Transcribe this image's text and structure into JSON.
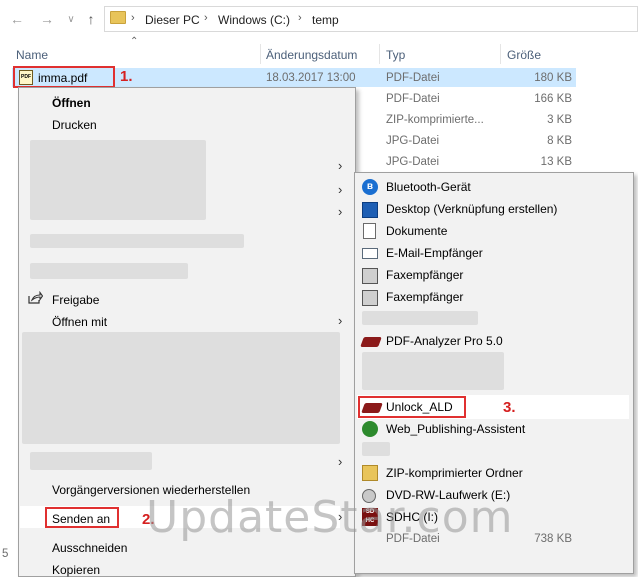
{
  "breadcrumb": [
    "Dieser PC",
    "Windows (C:)",
    "temp"
  ],
  "columns": {
    "name": "Name",
    "date": "Änderungsdatum",
    "type": "Typ",
    "size": "Größe"
  },
  "selected_file": {
    "name": "imma.pdf",
    "date": "18.03.2017 13:00",
    "type": "PDF-Datei",
    "size": "180 KB"
  },
  "files": [
    {
      "type": "PDF-Datei",
      "size": "166 KB"
    },
    {
      "type": "ZIP-komprimierte...",
      "size": "3 KB"
    },
    {
      "type": "JPG-Datei",
      "size": "8 KB"
    },
    {
      "type": "JPG-Datei",
      "size": "13 KB"
    }
  ],
  "last_row": {
    "type": "PDF-Datei",
    "size": "738 KB"
  },
  "left_stub": "5",
  "context_menu": {
    "open": "Öffnen",
    "print": "Drucken",
    "share": "Freigabe",
    "open_with": "Öffnen mit",
    "restore": "Vorgängerversionen wiederherstellen",
    "send_to": "Senden an",
    "cut": "Ausschneiden",
    "copy": "Kopieren"
  },
  "send_to_menu": {
    "bluetooth": "Bluetooth-Gerät",
    "desktop": "Desktop (Verknüpfung erstellen)",
    "documents": "Dokumente",
    "mail": "E-Mail-Empfänger",
    "fax1": "Faxempfänger",
    "fax2": "Faxempfänger",
    "pdf_analyzer": "PDF-Analyzer Pro 5.0",
    "unlock": "Unlock_ALD",
    "web_publishing": "Web_Publishing-Assistent",
    "zip": "ZIP-komprimierter Ordner",
    "dvd": "DVD-RW-Laufwerk (E:)",
    "sdhc": "SDHC (I:)"
  },
  "steps": [
    "1.",
    "2.",
    "3."
  ],
  "watermark": "UpdateStar.com",
  "colors": {
    "selection": "#cce8ff",
    "annotation_red": "#e03030",
    "menu_bg": "#f2f2f2",
    "header_text": "#4c607a"
  }
}
